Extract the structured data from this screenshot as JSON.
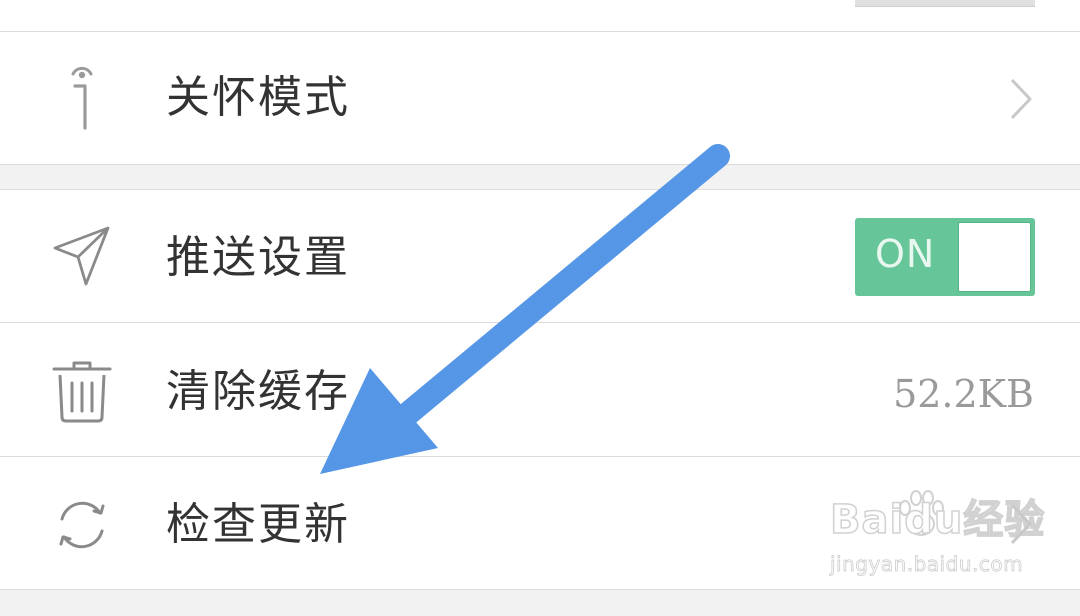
{
  "settings": {
    "items": [
      {
        "label": "关怀模式",
        "icon": "accessibility-icon",
        "trailing": "chevron"
      },
      {
        "label": "推送设置",
        "icon": "send-icon",
        "trailing": "toggle",
        "toggle_text": "ON",
        "toggle_on": true
      },
      {
        "label": "清除缓存",
        "icon": "trash-icon",
        "trailing": "value",
        "value": "52.2KB"
      },
      {
        "label": "检查更新",
        "icon": "refresh-icon",
        "trailing": "chevron"
      }
    ]
  },
  "colors": {
    "toggle_on": "#66c599",
    "annotation_arrow": "#5596e6",
    "label_text": "#333333",
    "value_text": "#9a9a9a"
  },
  "watermark": {
    "logo": "Baidu经验",
    "url": "jingyan.baidu.com"
  }
}
